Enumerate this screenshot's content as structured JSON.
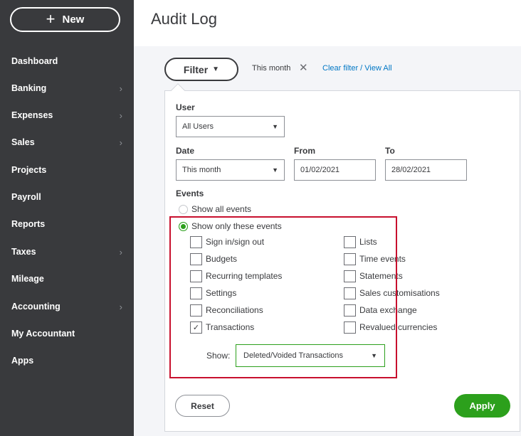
{
  "sidebar": {
    "new_label": "New",
    "items": [
      {
        "label": "Dashboard",
        "chevron": ""
      },
      {
        "label": "Banking",
        "chevron": "›"
      },
      {
        "label": "Expenses",
        "chevron": "›"
      },
      {
        "label": "Sales",
        "chevron": "›"
      },
      {
        "label": "Projects",
        "chevron": ""
      },
      {
        "label": "Payroll",
        "chevron": ""
      },
      {
        "label": "Reports",
        "chevron": ""
      },
      {
        "label": "Taxes",
        "chevron": "›"
      },
      {
        "label": "Mileage",
        "chevron": ""
      },
      {
        "label": "Accounting",
        "chevron": "›"
      },
      {
        "label": "My Accountant",
        "chevron": ""
      },
      {
        "label": "Apps",
        "chevron": ""
      }
    ]
  },
  "header": {
    "title": "Audit Log"
  },
  "filter": {
    "button_label": "Filter",
    "active_filter": "This month",
    "clear_link": "Clear filter / View All"
  },
  "form": {
    "user_label": "User",
    "user_value": "All Users",
    "date_label": "Date",
    "date_value": "This month",
    "from_label": "From",
    "from_value": "01/02/2021",
    "to_label": "To",
    "to_value": "28/02/2021",
    "events_label": "Events",
    "radio_all": "Show all events",
    "radio_only": "Show only these events",
    "radio_selected": "only",
    "checkboxes": [
      {
        "label": "Sign in/sign out",
        "checked": false
      },
      {
        "label": "Budgets",
        "checked": false
      },
      {
        "label": "Recurring templates",
        "checked": false
      },
      {
        "label": "Settings",
        "checked": false
      },
      {
        "label": "Reconciliations",
        "checked": false
      },
      {
        "label": "Transactions",
        "checked": true
      },
      {
        "label": "Lists",
        "checked": false
      },
      {
        "label": "Time events",
        "checked": false
      },
      {
        "label": "Statements",
        "checked": false
      },
      {
        "label": "Sales customisations",
        "checked": false
      },
      {
        "label": "Data exchange",
        "checked": false
      },
      {
        "label": "Revalued currencies",
        "checked": false
      }
    ],
    "show_label": "Show:",
    "show_value": "Deleted/Voided Transactions"
  },
  "actions": {
    "reset": "Reset",
    "apply": "Apply"
  },
  "colors": {
    "sidebar_bg": "#393a3d",
    "accent_green": "#2ca01c",
    "link_blue": "#0077c5",
    "highlight_red": "#c8102e"
  }
}
